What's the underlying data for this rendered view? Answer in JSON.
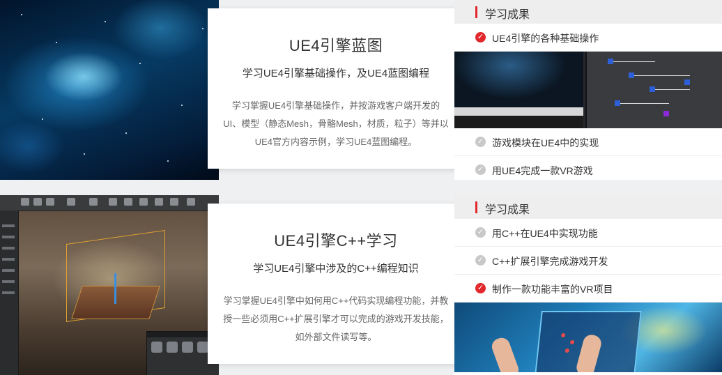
{
  "courses": [
    {
      "title": "UE4引擎蓝图",
      "subtitle": "学习UE4引擎基础操作，及UE4蓝图编程",
      "description": "学习掌握UE4引擎基础操作，并按游戏客户端开发的UI、模型（静态Mesh，骨骼Mesh，材质，粒子）等并以UE4官方内容示例，学习UE4蓝图编程。",
      "outcomes_title": "学习成果",
      "outcomes": [
        {
          "label": "UE4引擎的各种基础操作",
          "active": true
        },
        {
          "label": "游戏模块在UE4中的实现",
          "active": false
        },
        {
          "label": "用UE4完成一款VR游戏",
          "active": false
        }
      ]
    },
    {
      "title": "UE4引擎C++学习",
      "subtitle": "学习UE4引擎中涉及的C++编程知识",
      "description": "学习掌握UE4引擎中如何用C++代码实现编程功能，并教授一些必须用C++扩展引擎才可以完成的游戏开发技能，如外部文件读写等。",
      "outcomes_title": "学习成果",
      "outcomes": [
        {
          "label": "用C++在UE4中实现功能",
          "active": false
        },
        {
          "label": "C++扩展引擎完成游戏开发",
          "active": false
        },
        {
          "label": "制作一款功能丰富的VR项目",
          "active": true
        }
      ]
    }
  ],
  "colors": {
    "accent": "#e2282c",
    "inactive_icon": "#c8c8c8"
  },
  "icons": {
    "check": "check-circle-icon"
  }
}
